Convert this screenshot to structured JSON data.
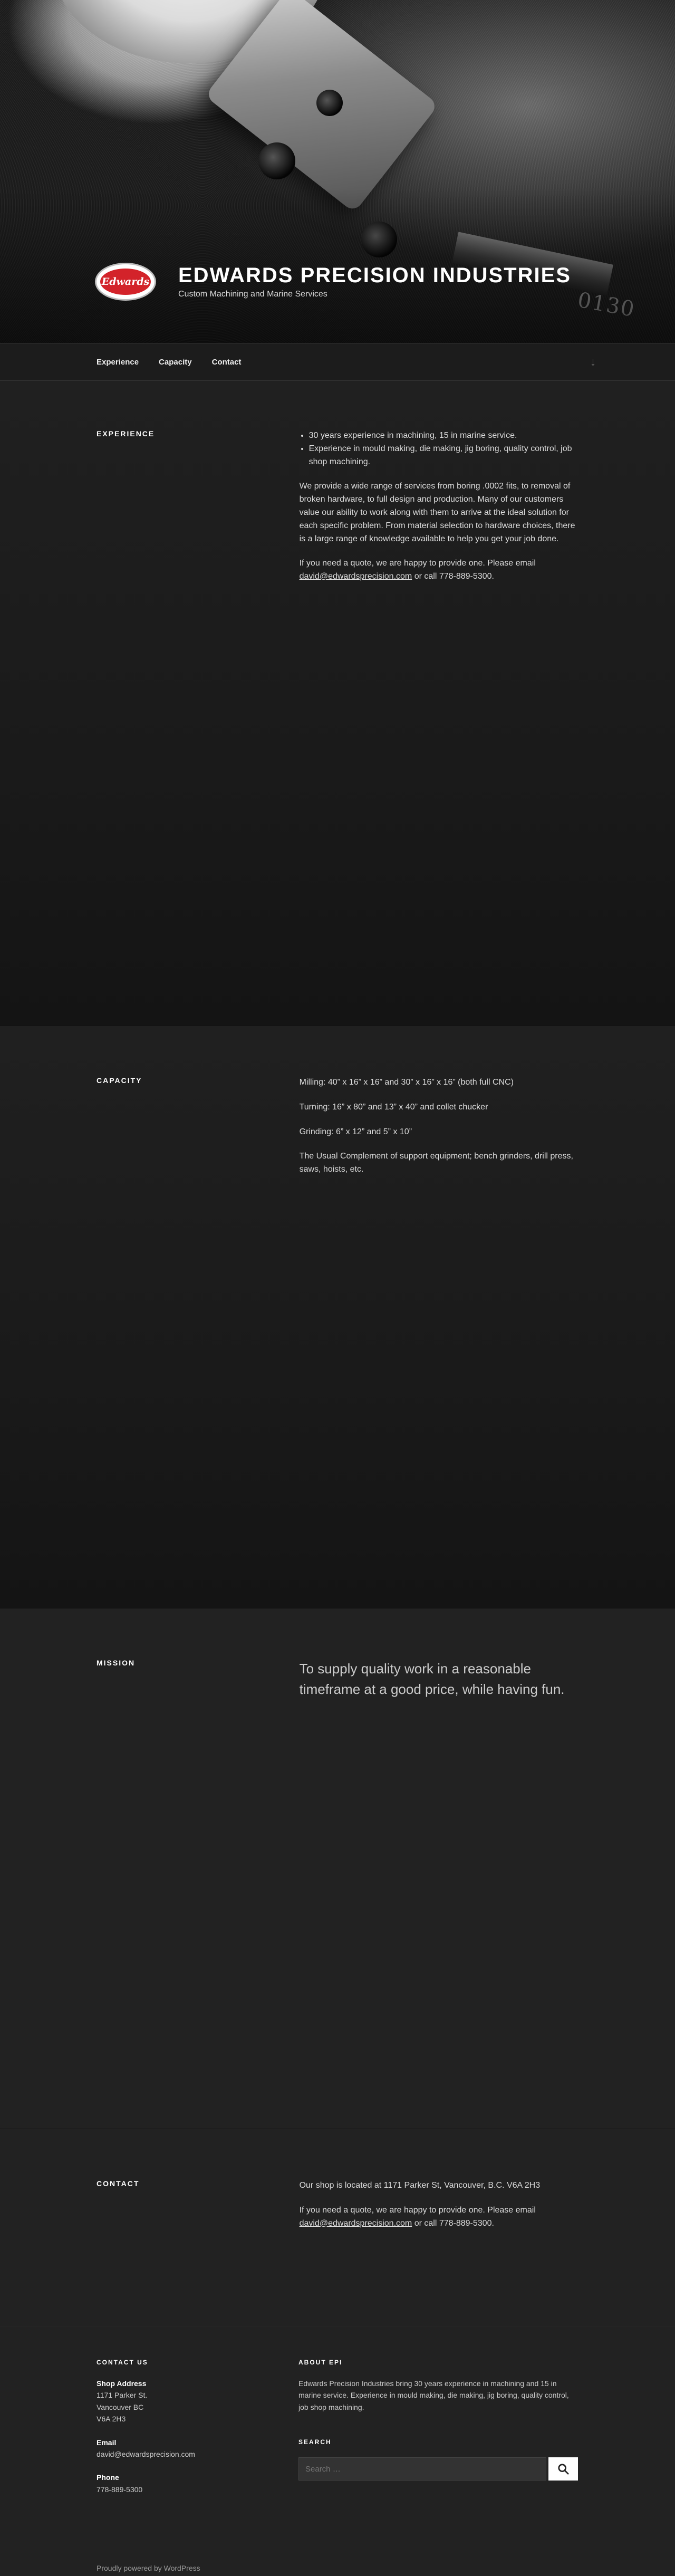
{
  "site": {
    "title": "Edwards Precision Industries",
    "description": "Custom Machining and Marine Services",
    "logo_text": "Edwards"
  },
  "nav": {
    "items": [
      "Experience",
      "Capacity",
      "Contact"
    ]
  },
  "experience": {
    "title": "Experience",
    "bullets": [
      "30 years experience in machining, 15 in marine service.",
      "Experience in mould making, die making, jig boring, quality control, job shop machining."
    ],
    "para": "We provide a wide range of services from boring .0002 fits, to removal of broken hardware, to full design and production. Many of our customers value our ability to work along with them to arrive at the ideal solution for each specific problem. From material selection to hardware choices, there is a large range of knowledge available to help you get your job done.",
    "quote_pre": "If you need a quote, we are happy to provide one. Please email ",
    "email": "david@edwardsprecision.com",
    "quote_post": " or call 778-889-5300."
  },
  "capacity": {
    "title": "Capacity",
    "lines": [
      "Milling: 40” x 16” x 16” and 30” x 16” x 16” (both full CNC)",
      "Turning: 16” x 80” and 13” x 40” and collet chucker",
      "Grinding: 6” x 12” and 5” x 10”",
      "The Usual Complement of support equipment; bench grinders, drill press, saws, hoists, etc."
    ]
  },
  "mission": {
    "title": "Mission",
    "quote": "To supply quality work in a reasonable timeframe at a good price, while having fun."
  },
  "contact": {
    "title": "Contact",
    "location": "Our shop is located at 1171 Parker St, Vancouver, B.C. V6A 2H3",
    "quote_pre": "If you need a quote, we are happy to provide one. Please email ",
    "email": "david@edwardsprecision.com",
    "quote_post": " or call 778-889-5300."
  },
  "footer": {
    "contact_title": "Contact Us",
    "address_label": "Shop Address",
    "address_lines": [
      "1171 Parker St.",
      "Vancouver BC",
      "V6A 2H3"
    ],
    "email_label": "Email",
    "email": "david@edwardsprecision.com",
    "phone_label": "Phone",
    "phone": "778-889-5300",
    "about_title": "About EPI",
    "about_text": "Edwards Precision Industries bring 30 years experience in machining and 15 in marine service. Experience in mould making, die making, jig boring, quality control, job shop machining.",
    "search_title": "Search",
    "search_placeholder": "Search …",
    "powered": "Proudly powered by WordPress"
  },
  "icons": {
    "search": "search-icon",
    "scroll_down": "arrow-down-icon"
  }
}
